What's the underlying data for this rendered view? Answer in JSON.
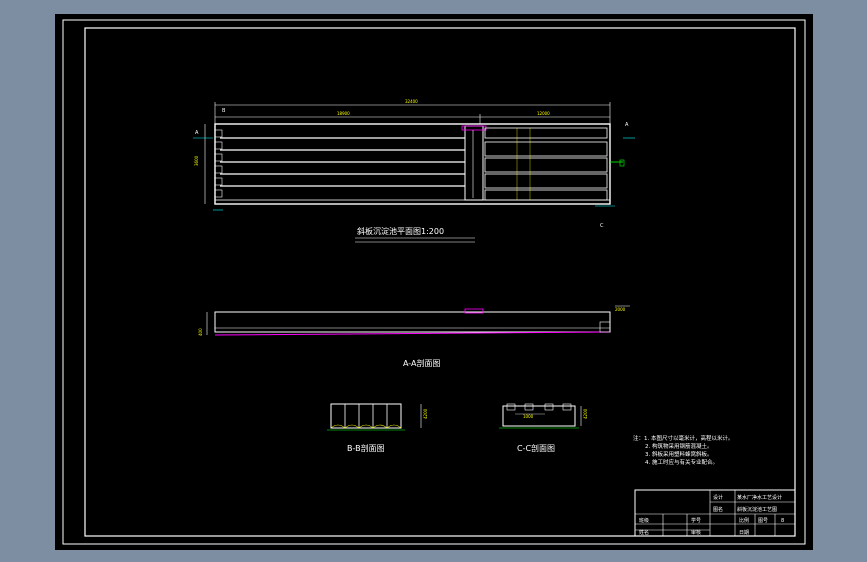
{
  "drawing": {
    "views": {
      "plan_title": "斜板沉淀池平面图1:200",
      "section_aa_title": "A-A剖面图",
      "section_bb_title": "B-B剖面图",
      "section_cc_title": "C-C剖面图"
    },
    "section_markers": {
      "a": "A",
      "b": "B",
      "c": "C"
    },
    "dimensions": {
      "overall_length": "32400",
      "left_length": "18900",
      "right_length": "12000",
      "left_width": "3600",
      "section_aa_height": "2000",
      "section_aa_left": "400",
      "section_bb_height": "4200",
      "section_cc_height": "4200",
      "section_cc_inner": "1000"
    },
    "notes": [
      "注：1. 本图尺寸以毫米计，高程以米计。",
      "2. 构筑物采用钢筋混凝土。",
      "3. 斜板采用塑料蜂窝斜板。",
      "4. 施工时应与有关专业配合。"
    ]
  },
  "title_block": {
    "project": "某水厂净水工艺设计",
    "drawing_name": "斜板沉淀池工艺图",
    "designed_label": "设计",
    "checked_label": "审核",
    "scale_label": "比例",
    "date_label": "日期",
    "drawing_no_label": "图号",
    "sheet_label": "图名",
    "sheet_no": "8",
    "class_label": "班级",
    "name_label": "姓名",
    "student_no_label": "学号"
  },
  "colors": {
    "background": "#7d8ea3",
    "canvas": "#000000",
    "lines": "#ffffff",
    "dimensions": "#ffff00",
    "accent": "#ff00ff",
    "cyan": "#00ffff"
  }
}
